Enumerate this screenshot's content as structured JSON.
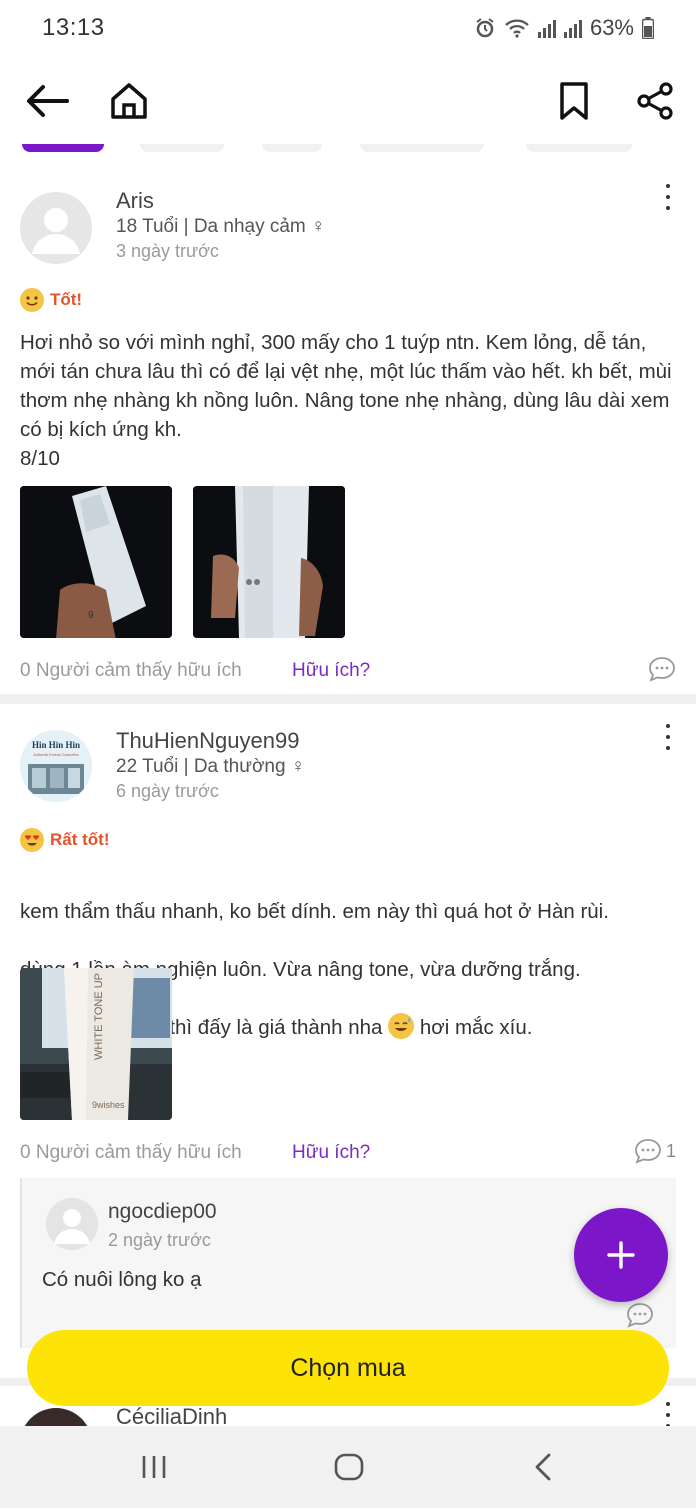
{
  "status_bar": {
    "time": "13:13",
    "battery": "63%"
  },
  "reviews": [
    {
      "username": "Aris",
      "meta": "18 Tuổi | Da nhạy cảm ♀",
      "time": "3 ngày trước",
      "rating": "Tốt!",
      "text": "Hơi nhỏ so với mình nghỉ, 300 mấy cho 1 tuýp ntn. Kem lỏng, dễ tán, mới tán chưa lâu thì có để lại vệt nhẹ, một lúc thấm vào hết. kh bết, mùi thơm nhẹ nhàng kh nồng luôn. Nâng tone nhẹ nhàng, dùng lâu dài xem có bị kích ứng kh.\n8/10",
      "helpful_count": "0 Người cảm thấy hữu ích",
      "helpful_link": "Hữu ích?"
    },
    {
      "username": "ThuHienNguyen99",
      "meta": "22 Tuổi | Da thường ♀",
      "time": "6 ngày trước",
      "rating": "Rất tốt!",
      "text_line1": "kem thẩm thấu nhanh, ko bết dính. em này thì quá hot ở Hàn rùi.",
      "text_line2": "dùng 1 lần àm nghiện luôn. Vừa nâng tone, vừa dưỡng trắng.",
      "text_line3a": "nếu có điểm trừ thì đấy là giá thành nha",
      "text_line3b": "hơi mắc xíu.",
      "avatar_text": "Hin Hin Hin",
      "avatar_subtext": "Authentic Korean Cosmetics",
      "photo_text": "WHITE TONE UP",
      "photo_brand": "9wishes",
      "helpful_count": "0 Người cảm thấy hữu ích",
      "helpful_link": "Hữu ích?",
      "comment_count": "1",
      "reply": {
        "username": "ngocdiep00",
        "time": "2 ngày trước",
        "text": "Có nuôi lông ko ạ"
      }
    },
    {
      "username": "CéciliaDinh"
    }
  ],
  "buy_button": {
    "label": "Chọn mua"
  },
  "colors": {
    "accent": "#7c17c9",
    "buy": "#fde306",
    "link": "#7b2cc0",
    "rating": "#e2542b"
  }
}
